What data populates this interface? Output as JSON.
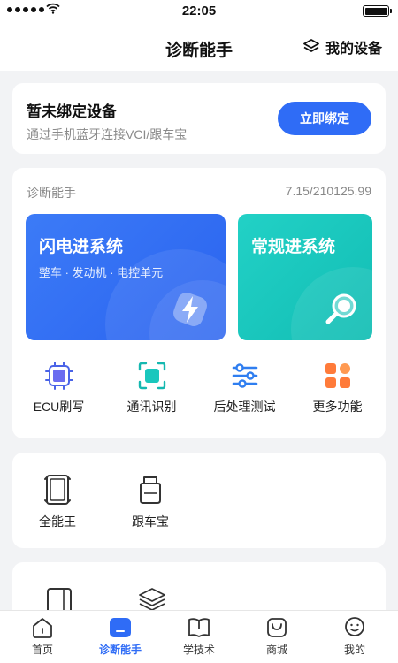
{
  "status_bar": {
    "time": "22:05"
  },
  "header": {
    "title": "诊断能手",
    "my_device_label": "我的设备",
    "my_device_icon": "layers-icon"
  },
  "bind_card": {
    "title": "暂未绑定设备",
    "subtitle": "通过手机蓝牙连接VCI/跟车宝",
    "button_label": "立即绑定"
  },
  "diagnosis": {
    "name": "诊断能手",
    "version": "7.15/210125.99",
    "tiles": [
      {
        "title": "闪电进系统",
        "subtitle": "整车 · 发动机 · 电控单元",
        "icon": "lightning-icon"
      },
      {
        "title": "常规进系统",
        "icon": "magnifier-icon"
      }
    ],
    "functions": [
      {
        "label": "ECU刷写",
        "icon": "chip-icon"
      },
      {
        "label": "通讯识别",
        "icon": "scan-icon"
      },
      {
        "label": "后处理测试",
        "icon": "sliders-icon"
      },
      {
        "label": "更多功能",
        "icon": "grid-icon"
      }
    ]
  },
  "tools": {
    "items": [
      {
        "label": "全能王",
        "icon": "tablet-icon"
      },
      {
        "label": "跟车宝",
        "icon": "obd-icon"
      }
    ]
  },
  "tab_bar": {
    "active": 1,
    "items": [
      {
        "label": "首页",
        "icon": "home-icon"
      },
      {
        "label": "诊断能手",
        "icon": "diagnose-icon"
      },
      {
        "label": "学技术",
        "icon": "book-icon"
      },
      {
        "label": "商城",
        "icon": "shop-bag-icon"
      },
      {
        "label": "我的",
        "icon": "profile-icon"
      }
    ]
  },
  "colors": {
    "accent": "#2f6cf6",
    "flash_tile": "#3371f4",
    "normal_tile": "#1ac7bd",
    "background": "#f2f3f5"
  }
}
